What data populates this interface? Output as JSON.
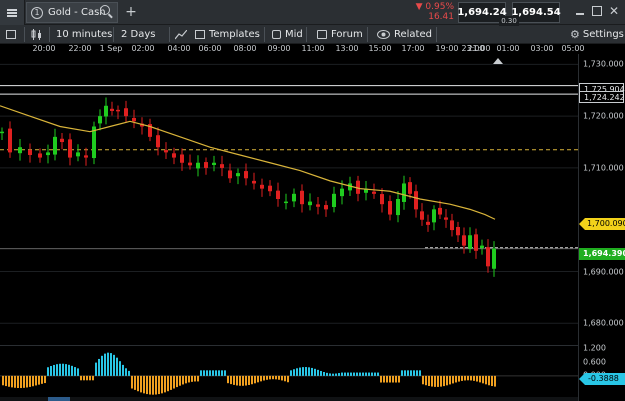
{
  "topbar": {
    "tab_number": "1",
    "tab_title": "Gold - Cash",
    "change_pct": "▼ 0.95%",
    "change_abs": "16.41",
    "sell_price": "1,694.24",
    "spread": "0.30",
    "buy_price": "1,694.54"
  },
  "toolbar": {
    "interval": "10 minutes",
    "range": "2 Days",
    "templates": "Templates",
    "price_type": "Mid",
    "forum": "Forum",
    "related": "Related",
    "settings": "Settings"
  },
  "colors": {
    "up": "#1fcc1f",
    "down": "#e02020",
    "sma": "#d9b43a",
    "osc_pos": "#29c6e6",
    "osc_neg": "#f0a020"
  },
  "chart_data": {
    "type": "candlestick",
    "time_ticks": [
      "20:00",
      "22:00",
      "1 Sep",
      "02:00",
      "04:00",
      "06:00",
      "08:00",
      "09:00",
      "11:00",
      "13:00",
      "15:00",
      "17:00",
      "19:00",
      "21:00",
      "23:00",
      "01:00",
      "03:00",
      "05:00"
    ],
    "price_ticks": [
      "1,730.000",
      "1,720.000",
      "1,710.000",
      "1,690.000",
      "1,680.000"
    ],
    "ylim": [
      1676,
      1732
    ],
    "horizontal_lines": [
      {
        "label": "1,725.904",
        "value": 1725.904,
        "style": "solid"
      },
      {
        "label": "1,724.242",
        "value": 1724.242,
        "style": "solid"
      },
      {
        "value": 1713.5,
        "style": "dashed"
      }
    ],
    "sma_last": "1,700.090",
    "last_price": "1,694.390",
    "oscillator": {
      "ticks": [
        "1.200",
        "0.600",
        "0.000"
      ],
      "last": "-0.3888",
      "ylim": [
        -1.0,
        1.35
      ]
    }
  }
}
